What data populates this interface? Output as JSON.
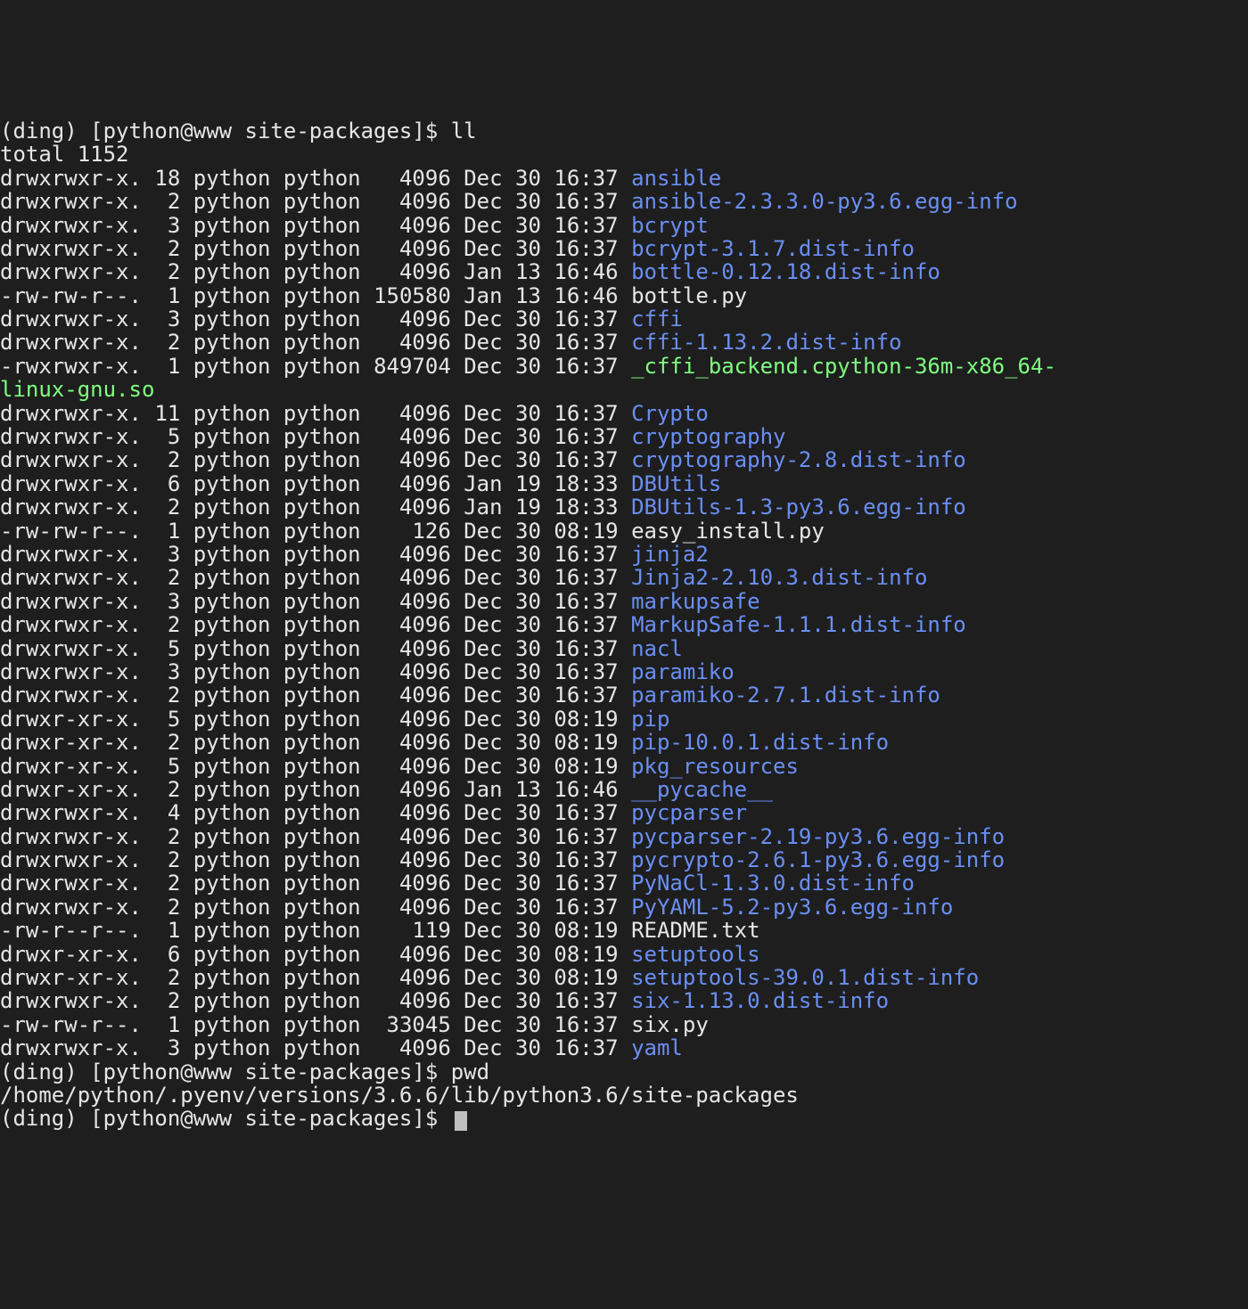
{
  "prompt1_prefix": "(ding) [python@www site-packages]$ ",
  "cmd_ll": "ll",
  "total_line": "total 1152",
  "rows": [
    {
      "perm": "drwxrwxr-x.",
      "links": "18",
      "user": "python",
      "group": "python",
      "size": "4096",
      "date": "Dec 30 16:37",
      "name": "ansible",
      "type": "dir"
    },
    {
      "perm": "drwxrwxr-x.",
      "links": "2",
      "user": "python",
      "group": "python",
      "size": "4096",
      "date": "Dec 30 16:37",
      "name": "ansible-2.3.3.0-py3.6.egg-info",
      "type": "dir"
    },
    {
      "perm": "drwxrwxr-x.",
      "links": "3",
      "user": "python",
      "group": "python",
      "size": "4096",
      "date": "Dec 30 16:37",
      "name": "bcrypt",
      "type": "dir"
    },
    {
      "perm": "drwxrwxr-x.",
      "links": "2",
      "user": "python",
      "group": "python",
      "size": "4096",
      "date": "Dec 30 16:37",
      "name": "bcrypt-3.1.7.dist-info",
      "type": "dir"
    },
    {
      "perm": "drwxrwxr-x.",
      "links": "2",
      "user": "python",
      "group": "python",
      "size": "4096",
      "date": "Jan 13 16:46",
      "name": "bottle-0.12.18.dist-info",
      "type": "dir"
    },
    {
      "perm": "-rw-rw-r--.",
      "links": "1",
      "user": "python",
      "group": "python",
      "size": "150580",
      "date": "Jan 13 16:46",
      "name": "bottle.py",
      "type": "file"
    },
    {
      "perm": "drwxrwxr-x.",
      "links": "3",
      "user": "python",
      "group": "python",
      "size": "4096",
      "date": "Dec 30 16:37",
      "name": "cffi",
      "type": "dir"
    },
    {
      "perm": "drwxrwxr-x.",
      "links": "2",
      "user": "python",
      "group": "python",
      "size": "4096",
      "date": "Dec 30 16:37",
      "name": "cffi-1.13.2.dist-info",
      "type": "dir"
    },
    {
      "perm": "-rwxrwxr-x.",
      "links": "1",
      "user": "python",
      "group": "python",
      "size": "849704",
      "date": "Dec 30 16:37",
      "name": "_cffi_backend.cpython-36m-x86_64-",
      "type": "exec",
      "wrap": "linux-gnu.so"
    },
    {
      "perm": "drwxrwxr-x.",
      "links": "11",
      "user": "python",
      "group": "python",
      "size": "4096",
      "date": "Dec 30 16:37",
      "name": "Crypto",
      "type": "dir"
    },
    {
      "perm": "drwxrwxr-x.",
      "links": "5",
      "user": "python",
      "group": "python",
      "size": "4096",
      "date": "Dec 30 16:37",
      "name": "cryptography",
      "type": "dir"
    },
    {
      "perm": "drwxrwxr-x.",
      "links": "2",
      "user": "python",
      "group": "python",
      "size": "4096",
      "date": "Dec 30 16:37",
      "name": "cryptography-2.8.dist-info",
      "type": "dir"
    },
    {
      "perm": "drwxrwxr-x.",
      "links": "6",
      "user": "python",
      "group": "python",
      "size": "4096",
      "date": "Jan 19 18:33",
      "name": "DBUtils",
      "type": "dir"
    },
    {
      "perm": "drwxrwxr-x.",
      "links": "2",
      "user": "python",
      "group": "python",
      "size": "4096",
      "date": "Jan 19 18:33",
      "name": "DBUtils-1.3-py3.6.egg-info",
      "type": "dir"
    },
    {
      "perm": "-rw-rw-r--.",
      "links": "1",
      "user": "python",
      "group": "python",
      "size": "126",
      "date": "Dec 30 08:19",
      "name": "easy_install.py",
      "type": "file"
    },
    {
      "perm": "drwxrwxr-x.",
      "links": "3",
      "user": "python",
      "group": "python",
      "size": "4096",
      "date": "Dec 30 16:37",
      "name": "jinja2",
      "type": "dir"
    },
    {
      "perm": "drwxrwxr-x.",
      "links": "2",
      "user": "python",
      "group": "python",
      "size": "4096",
      "date": "Dec 30 16:37",
      "name": "Jinja2-2.10.3.dist-info",
      "type": "dir"
    },
    {
      "perm": "drwxrwxr-x.",
      "links": "3",
      "user": "python",
      "group": "python",
      "size": "4096",
      "date": "Dec 30 16:37",
      "name": "markupsafe",
      "type": "dir"
    },
    {
      "perm": "drwxrwxr-x.",
      "links": "2",
      "user": "python",
      "group": "python",
      "size": "4096",
      "date": "Dec 30 16:37",
      "name": "MarkupSafe-1.1.1.dist-info",
      "type": "dir"
    },
    {
      "perm": "drwxrwxr-x.",
      "links": "5",
      "user": "python",
      "group": "python",
      "size": "4096",
      "date": "Dec 30 16:37",
      "name": "nacl",
      "type": "dir"
    },
    {
      "perm": "drwxrwxr-x.",
      "links": "3",
      "user": "python",
      "group": "python",
      "size": "4096",
      "date": "Dec 30 16:37",
      "name": "paramiko",
      "type": "dir"
    },
    {
      "perm": "drwxrwxr-x.",
      "links": "2",
      "user": "python",
      "group": "python",
      "size": "4096",
      "date": "Dec 30 16:37",
      "name": "paramiko-2.7.1.dist-info",
      "type": "dir"
    },
    {
      "perm": "drwxr-xr-x.",
      "links": "5",
      "user": "python",
      "group": "python",
      "size": "4096",
      "date": "Dec 30 08:19",
      "name": "pip",
      "type": "dir"
    },
    {
      "perm": "drwxr-xr-x.",
      "links": "2",
      "user": "python",
      "group": "python",
      "size": "4096",
      "date": "Dec 30 08:19",
      "name": "pip-10.0.1.dist-info",
      "type": "dir"
    },
    {
      "perm": "drwxr-xr-x.",
      "links": "5",
      "user": "python",
      "group": "python",
      "size": "4096",
      "date": "Dec 30 08:19",
      "name": "pkg_resources",
      "type": "dir"
    },
    {
      "perm": "drwxr-xr-x.",
      "links": "2",
      "user": "python",
      "group": "python",
      "size": "4096",
      "date": "Jan 13 16:46",
      "name": "__pycache__",
      "type": "dir"
    },
    {
      "perm": "drwxrwxr-x.",
      "links": "4",
      "user": "python",
      "group": "python",
      "size": "4096",
      "date": "Dec 30 16:37",
      "name": "pycparser",
      "type": "dir"
    },
    {
      "perm": "drwxrwxr-x.",
      "links": "2",
      "user": "python",
      "group": "python",
      "size": "4096",
      "date": "Dec 30 16:37",
      "name": "pycparser-2.19-py3.6.egg-info",
      "type": "dir"
    },
    {
      "perm": "drwxrwxr-x.",
      "links": "2",
      "user": "python",
      "group": "python",
      "size": "4096",
      "date": "Dec 30 16:37",
      "name": "pycrypto-2.6.1-py3.6.egg-info",
      "type": "dir"
    },
    {
      "perm": "drwxrwxr-x.",
      "links": "2",
      "user": "python",
      "group": "python",
      "size": "4096",
      "date": "Dec 30 16:37",
      "name": "PyNaCl-1.3.0.dist-info",
      "type": "dir"
    },
    {
      "perm": "drwxrwxr-x.",
      "links": "2",
      "user": "python",
      "group": "python",
      "size": "4096",
      "date": "Dec 30 16:37",
      "name": "PyYAML-5.2-py3.6.egg-info",
      "type": "dir"
    },
    {
      "perm": "-rw-r--r--.",
      "links": "1",
      "user": "python",
      "group": "python",
      "size": "119",
      "date": "Dec 30 08:19",
      "name": "README.txt",
      "type": "file"
    },
    {
      "perm": "drwxr-xr-x.",
      "links": "6",
      "user": "python",
      "group": "python",
      "size": "4096",
      "date": "Dec 30 08:19",
      "name": "setuptools",
      "type": "dir"
    },
    {
      "perm": "drwxr-xr-x.",
      "links": "2",
      "user": "python",
      "group": "python",
      "size": "4096",
      "date": "Dec 30 08:19",
      "name": "setuptools-39.0.1.dist-info",
      "type": "dir"
    },
    {
      "perm": "drwxrwxr-x.",
      "links": "2",
      "user": "python",
      "group": "python",
      "size": "4096",
      "date": "Dec 30 16:37",
      "name": "six-1.13.0.dist-info",
      "type": "dir"
    },
    {
      "perm": "-rw-rw-r--.",
      "links": "1",
      "user": "python",
      "group": "python",
      "size": "33045",
      "date": "Dec 30 16:37",
      "name": "six.py",
      "type": "file"
    },
    {
      "perm": "drwxrwxr-x.",
      "links": "3",
      "user": "python",
      "group": "python",
      "size": "4096",
      "date": "Dec 30 16:37",
      "name": "yaml",
      "type": "dir"
    }
  ],
  "prompt2_prefix": "(ding) [python@www site-packages]$ ",
  "cmd_pwd": "pwd",
  "pwd_output": "/home/python/.pyenv/versions/3.6.6/lib/python3.6/site-packages",
  "prompt3_prefix": "(ding) [python@www site-packages]$ "
}
